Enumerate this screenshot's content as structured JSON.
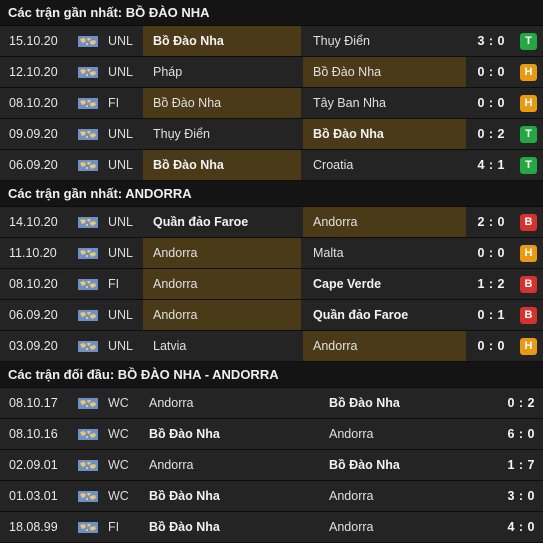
{
  "sections": [
    {
      "title": "Các trận gần nhất: BỒ ĐÀO NHA",
      "layout": "recent",
      "rows": [
        {
          "date": "15.10.20",
          "comp": "UNL",
          "home": "Bồ Đào Nha",
          "away": "Thụy Điển",
          "score": "3 : 0",
          "result": "T",
          "home_bold": true,
          "away_bold": false,
          "home_hl": true,
          "away_hl": false
        },
        {
          "date": "12.10.20",
          "comp": "UNL",
          "home": "Pháp",
          "away": "Bồ Đào Nha",
          "score": "0 : 0",
          "result": "H",
          "home_bold": false,
          "away_bold": false,
          "home_hl": false,
          "away_hl": true
        },
        {
          "date": "08.10.20",
          "comp": "FI",
          "home": "Bồ Đào Nha",
          "away": "Tây Ban Nha",
          "score": "0 : 0",
          "result": "H",
          "home_bold": false,
          "away_bold": false,
          "home_hl": true,
          "away_hl": false
        },
        {
          "date": "09.09.20",
          "comp": "UNL",
          "home": "Thụy Điển",
          "away": "Bồ Đào Nha",
          "score": "0 : 2",
          "result": "T",
          "home_bold": false,
          "away_bold": true,
          "home_hl": false,
          "away_hl": true
        },
        {
          "date": "06.09.20",
          "comp": "UNL",
          "home": "Bồ Đào Nha",
          "away": "Croatia",
          "score": "4 : 1",
          "result": "T",
          "home_bold": true,
          "away_bold": false,
          "home_hl": true,
          "away_hl": false
        }
      ]
    },
    {
      "title": "Các trận gần nhất: ANDORRA",
      "layout": "recent",
      "rows": [
        {
          "date": "14.10.20",
          "comp": "UNL",
          "home": "Quần đảo Faroe",
          "away": "Andorra",
          "score": "2 : 0",
          "result": "B",
          "home_bold": true,
          "away_bold": false,
          "home_hl": false,
          "away_hl": true
        },
        {
          "date": "11.10.20",
          "comp": "UNL",
          "home": "Andorra",
          "away": "Malta",
          "score": "0 : 0",
          "result": "H",
          "home_bold": false,
          "away_bold": false,
          "home_hl": true,
          "away_hl": false
        },
        {
          "date": "08.10.20",
          "comp": "FI",
          "home": "Andorra",
          "away": "Cape Verde",
          "score": "1 : 2",
          "result": "B",
          "home_bold": false,
          "away_bold": true,
          "home_hl": true,
          "away_hl": false
        },
        {
          "date": "06.09.20",
          "comp": "UNL",
          "home": "Andorra",
          "away": "Quần đảo Faroe",
          "score": "0 : 1",
          "result": "B",
          "home_bold": false,
          "away_bold": true,
          "home_hl": true,
          "away_hl": false
        },
        {
          "date": "03.09.20",
          "comp": "UNL",
          "home": "Latvia",
          "away": "Andorra",
          "score": "0 : 0",
          "result": "H",
          "home_bold": false,
          "away_bold": false,
          "home_hl": false,
          "away_hl": true
        }
      ]
    },
    {
      "title": "Các trận đối đầu: BỒ ĐÀO NHA - ANDORRA",
      "layout": "h2h",
      "rows": [
        {
          "date": "08.10.17",
          "comp": "WC",
          "home": "Andorra",
          "away": "Bồ Đào Nha",
          "score": "0 : 2",
          "home_bold": false,
          "away_bold": true
        },
        {
          "date": "08.10.16",
          "comp": "WC",
          "home": "Bồ Đào Nha",
          "away": "Andorra",
          "score": "6 : 0",
          "home_bold": true,
          "away_bold": false
        },
        {
          "date": "02.09.01",
          "comp": "WC",
          "home": "Andorra",
          "away": "Bồ Đào Nha",
          "score": "1 : 7",
          "home_bold": false,
          "away_bold": true
        },
        {
          "date": "01.03.01",
          "comp": "WC",
          "home": "Bồ Đào Nha",
          "away": "Andorra",
          "score": "3 : 0",
          "home_bold": true,
          "away_bold": false
        },
        {
          "date": "18.08.99",
          "comp": "FI",
          "home": "Bồ Đào Nha",
          "away": "Andorra",
          "score": "4 : 0",
          "home_bold": true,
          "away_bold": false
        }
      ]
    }
  ],
  "icons": {
    "competition": "world-map-flag-icon"
  },
  "colors": {
    "background": "#242424",
    "header": "#141414",
    "highlight": "#4a3a18",
    "win": "#27a744",
    "draw": "#e89a14",
    "loss": "#d6332f"
  }
}
